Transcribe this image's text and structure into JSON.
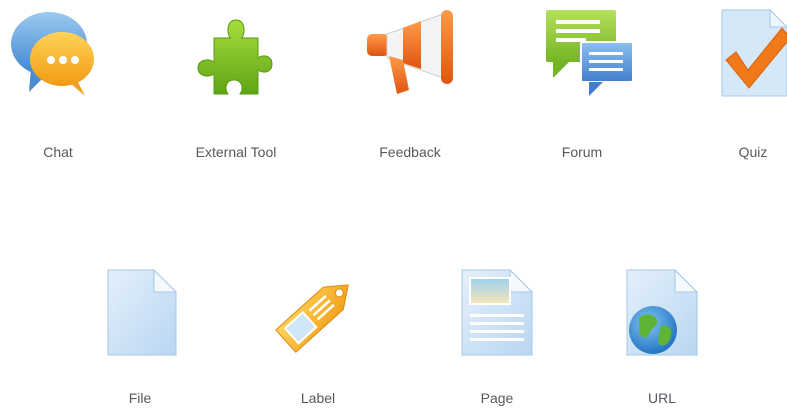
{
  "activity_chooser": {
    "row1": [
      {
        "label": "Chat",
        "icon": "chat-bubbles-icon"
      },
      {
        "label": "External Tool",
        "icon": "puzzle-piece-icon"
      },
      {
        "label": "Feedback",
        "icon": "megaphone-icon"
      },
      {
        "label": "Forum",
        "icon": "forum-bubbles-icon"
      },
      {
        "label": "Quiz",
        "icon": "quiz-checkmark-icon"
      }
    ],
    "row2": [
      {
        "label": "File",
        "icon": "file-icon"
      },
      {
        "label": "Label",
        "icon": "label-tag-icon"
      },
      {
        "label": "Page",
        "icon": "page-icon"
      },
      {
        "label": "URL",
        "icon": "url-globe-icon"
      }
    ]
  },
  "colors": {
    "label_text": "#555a60",
    "chat_blue": "#5b9bd8",
    "chat_orange": "#f6a623",
    "puzzle_green": "#7bbf1f",
    "megaphone_orange": "#e8661c",
    "forum_green": "#8cc63f",
    "forum_blue": "#4f8fd6",
    "doc_blue": "#cfe3f7",
    "check_orange": "#f07a1a"
  }
}
